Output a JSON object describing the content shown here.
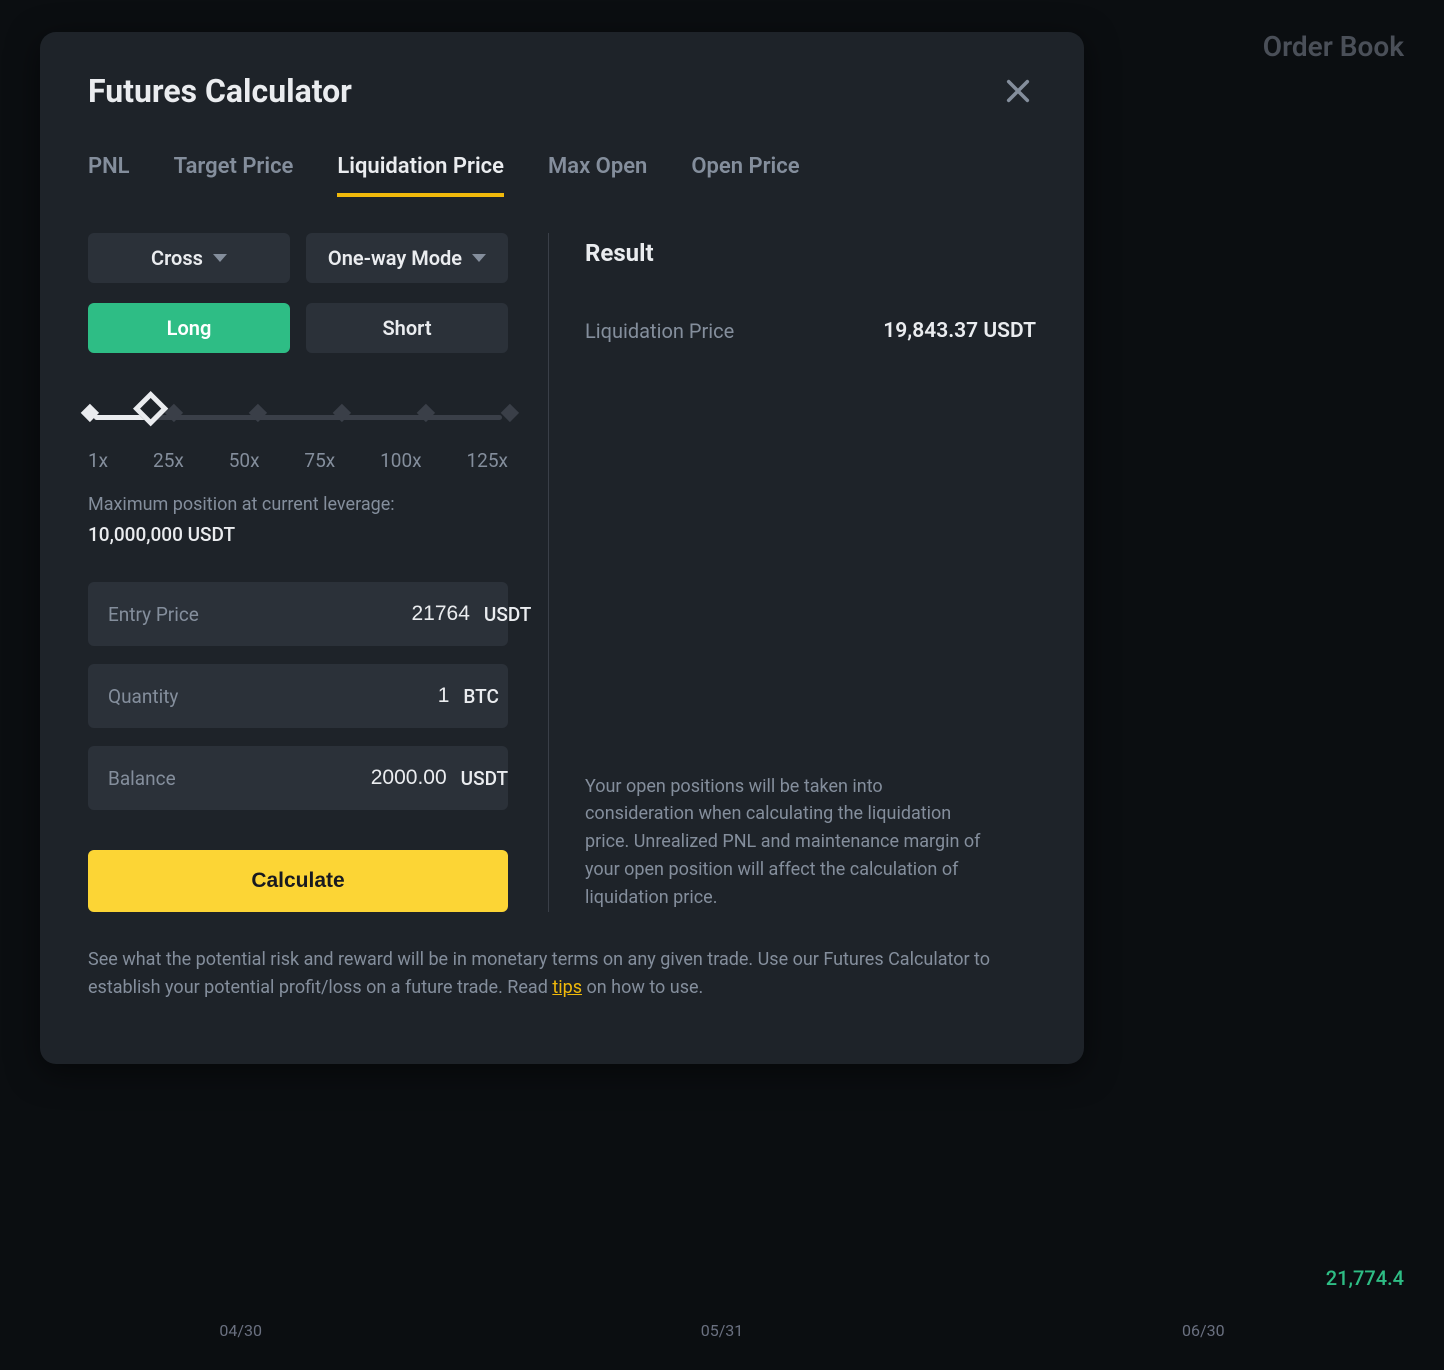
{
  "background": {
    "top_right_text": "Order Book",
    "bottom_right_number": "21,774.4",
    "axis_labels": [
      "04/30",
      "05/31",
      "06/30"
    ]
  },
  "modal": {
    "title": "Futures Calculator",
    "tabs": [
      "PNL",
      "Target Price",
      "Liquidation Price",
      "Max Open",
      "Open Price"
    ],
    "active_tab_index": 2,
    "margin_mode": "Cross",
    "position_mode": "One-way Mode",
    "direction_long": "Long",
    "direction_short": "Short",
    "leverage": {
      "ticks": [
        "1x",
        "25x",
        "50x",
        "75x",
        "100x",
        "125x"
      ],
      "fill_percent": 14,
      "thumb_percent": 14
    },
    "max_pos_label": "Maximum position at current leverage:",
    "max_pos_value": "10,000,000 USDT",
    "fields": [
      {
        "label": "Entry Price",
        "value": "21764",
        "unit": "USDT"
      },
      {
        "label": "Quantity",
        "value": "1",
        "unit": "BTC"
      },
      {
        "label": "Balance",
        "value": "2000.00",
        "unit": "USDT"
      }
    ],
    "calculate_label": "Calculate",
    "result": {
      "title": "Result",
      "label": "Liquidation Price",
      "value": "19,843.37 USDT"
    },
    "info_text": "Your open positions will be taken into consideration when calculating the liquidation price. Unrealized PNL and maintenance margin of your open position will affect the calculation of liquidation price.",
    "footer_prefix": "See what the potential risk and reward will be in monetary terms on any given trade. Use our Futures Calculator to establish your potential profit/loss on a future trade. Read ",
    "footer_link": "tips",
    "footer_suffix": " on how to use."
  }
}
